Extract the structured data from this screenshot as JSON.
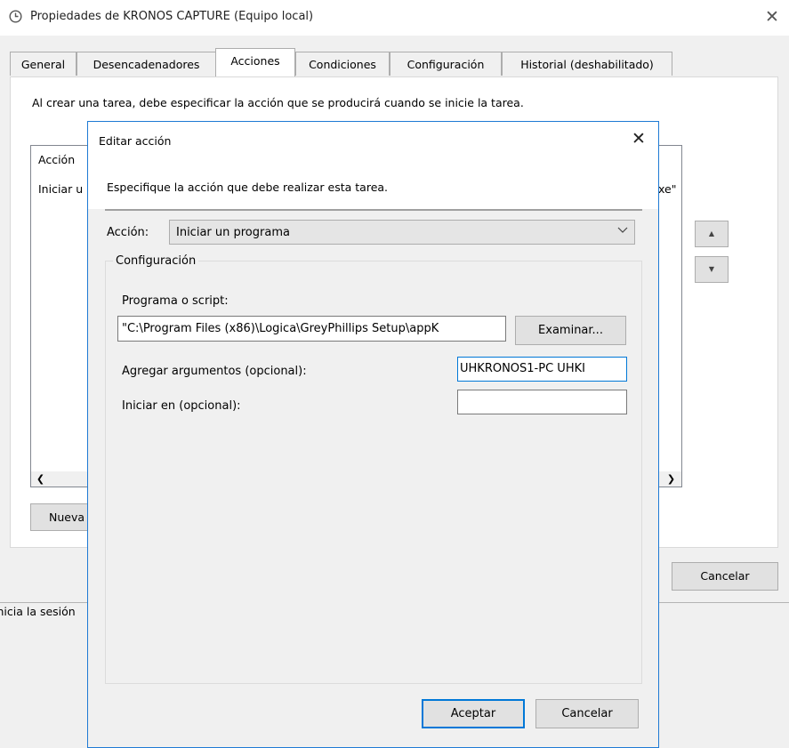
{
  "window": {
    "title": "Propiedades de KRONOS CAPTURE (Equipo local)",
    "close_icon": "close-icon"
  },
  "tabs": [
    {
      "label": "General"
    },
    {
      "label": "Desencadenadores"
    },
    {
      "label": "Acciones",
      "active": true
    },
    {
      "label": "Condiciones"
    },
    {
      "label": "Configuración"
    },
    {
      "label": "Historial (deshabilitado)"
    }
  ],
  "actions_tab": {
    "description": "Al crear una tarea, debe especificar la acción que se producirá cuando se inicie la tarea.",
    "table": {
      "column_header": "Acción",
      "row_start_text": "Iniciar u",
      "row_end_text": "xe\""
    },
    "new_button": "Nueva",
    "move_up_icon": "triangle-up-icon",
    "move_down_icon": "triangle-down-icon"
  },
  "footer": {
    "cancel": "Cancelar",
    "background_text": "inicia la sesión"
  },
  "dialog": {
    "title": "Editar acción",
    "prompt": "Especifique la acción que debe realizar esta tarea.",
    "action_label": "Acción:",
    "action_value": "Iniciar un programa",
    "config_legend": "Configuración",
    "program_label": "Programa o script:",
    "program_value": "\"C:\\Program Files (x86)\\Logica\\GreyPhillips Setup\\appK",
    "browse_button": "Examinar...",
    "args_label": "Agregar argumentos (opcional):",
    "args_value": "UHKRONOS1-PC UHKI",
    "start_in_label": "Iniciar en (opcional):",
    "start_in_value": "",
    "ok_button": "Aceptar",
    "cancel_button": "Cancelar"
  },
  "colors": {
    "dialog_border": "#1e7ad4",
    "focus": "#0078d7"
  }
}
